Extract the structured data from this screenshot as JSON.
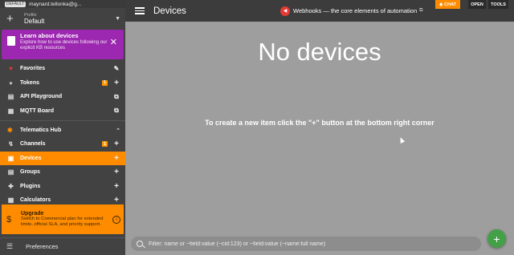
{
  "account": {
    "badge": "DEFAULT",
    "email": "maynard.tellonka@g..."
  },
  "profile": {
    "sub_label": "Profile",
    "name": "Default"
  },
  "promo": {
    "title": "Learn about devices",
    "text": "Explore how to use devices following our explicit KB resources"
  },
  "sidebar": {
    "top_items": [
      {
        "label": "Favorites",
        "icon": "heart-icon"
      },
      {
        "label": "Tokens",
        "icon": "token-icon",
        "badge": "1"
      },
      {
        "label": "API Playground",
        "icon": "api-icon"
      },
      {
        "label": "MQTT Board",
        "icon": "mqtt-icon"
      }
    ],
    "section": "Telematics Hub",
    "hub_items": [
      {
        "label": "Channels",
        "icon": "channels-icon",
        "badge": "1"
      },
      {
        "label": "Devices",
        "icon": "devices-icon"
      },
      {
        "label": "Groups",
        "icon": "groups-icon"
      },
      {
        "label": "Plugins",
        "icon": "plugins-icon"
      },
      {
        "label": "Calculators",
        "icon": "calculators-icon"
      }
    ]
  },
  "upgrade": {
    "title": "Upgrade",
    "text": "Switch to Commercial plan for extended limits, official SLA, and priority support."
  },
  "preferences_label": "Preferences",
  "header": {
    "title": "Devices",
    "webhook_text": "Webhooks — the core elements of automation",
    "chat_label": "CHAT",
    "open_label": "OPEN",
    "tools_label": "TOOLS"
  },
  "main": {
    "empty_title": "No devices",
    "hint": "To create a new item click the \"+\" button at the bottom right corner"
  },
  "filter": {
    "placeholder": "Filter: name or ~field:value (~cid:123) or ~field:value (~name:full name)"
  },
  "colors": {
    "accent": "#ff8c00",
    "promo": "#9c27b0",
    "fab": "#43a047"
  }
}
